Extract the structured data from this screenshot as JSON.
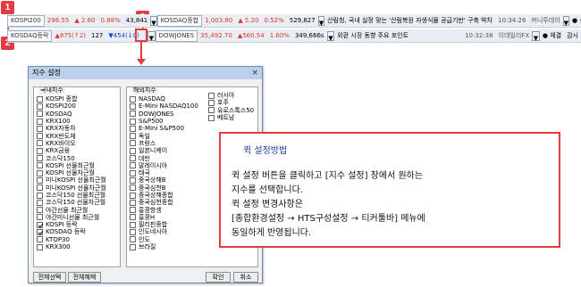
{
  "callouts": [
    "1",
    "2",
    "3"
  ],
  "ticker1": {
    "index_name": "KOSPI200",
    "value": "296.55",
    "change": "▲ 2.60",
    "pct": "0.88%",
    "volume": "43,841",
    "index_name2": "KOSDAQ종합",
    "value2": "1,003.80",
    "change2": "▲ 5.20",
    "pct2": "0.52%",
    "volume2": "529,827",
    "news": "산림청, 국내 실정 맞는 '산림복원 자생식물 공급기반' 구축 박차",
    "time": "10:34:26",
    "source": "머니투데이",
    "extra": "● 신호대기"
  },
  "ticker2": {
    "index_name": "KOSDAQ등락",
    "up": "▲875(↑2)",
    "flat": "127",
    "down": "▼454(↓0)",
    "index_name2": "DOWJONES",
    "value2": "35,492.70",
    "change2": "▲560.54",
    "pct2": "1.60%",
    "volume2": "349,666s",
    "news": "외환 시장 동향 주요 포인트",
    "time": "10:32:38",
    "source": "이데일리FX",
    "extra1": "● 체결",
    "extra2": "감시"
  },
  "dialog": {
    "title": "지수 설정",
    "close": "×",
    "domestic_title": "국내지수",
    "overseas_title": "해외지수",
    "domestic": [
      {
        "label": "KOSPI 종합",
        "checked": false
      },
      {
        "label": "KOSPI200",
        "checked": false
      },
      {
        "label": "KOSDAQ",
        "checked": false
      },
      {
        "label": "KRX100",
        "checked": false
      },
      {
        "label": "KRX자동차",
        "checked": false
      },
      {
        "label": "KRX반도체",
        "checked": false
      },
      {
        "label": "KRX바이오",
        "checked": false
      },
      {
        "label": "KRX금융",
        "checked": false
      },
      {
        "label": "코스닥150",
        "checked": false
      },
      {
        "label": "KOSPI 선물최근월",
        "checked": false
      },
      {
        "label": "KOSPI 선물차근월",
        "checked": false
      },
      {
        "label": "미니KOSPI 선물최근월",
        "checked": false
      },
      {
        "label": "미니KOSPI 선물차근월",
        "checked": false
      },
      {
        "label": "코스닥150 선물최근월",
        "checked": false
      },
      {
        "label": "코스닥150 선물차근월",
        "checked": false
      },
      {
        "label": "야간선물 최근월",
        "checked": false
      },
      {
        "label": "야간미니선물 최근월",
        "checked": false
      },
      {
        "label": "KOSPI 등락",
        "checked": true
      },
      {
        "label": "KOSDAQ 등락",
        "checked": true
      },
      {
        "label": "KTOP30",
        "checked": false
      },
      {
        "label": "KRX300",
        "checked": false
      }
    ],
    "overseas_col1": [
      {
        "label": "NASDAQ",
        "checked": false
      },
      {
        "label": "E-Mini NASDAQ100",
        "checked": false
      },
      {
        "label": "DOWJONES",
        "checked": false
      },
      {
        "label": "S&P500",
        "checked": false
      },
      {
        "label": "E-Mini S&P500",
        "checked": false
      },
      {
        "label": "독일",
        "checked": false
      },
      {
        "label": "프랑스",
        "checked": false
      },
      {
        "label": "일본니케이",
        "checked": false
      },
      {
        "label": "대만",
        "checked": false
      },
      {
        "label": "말레이시아",
        "checked": false
      },
      {
        "label": "태국",
        "checked": false
      },
      {
        "label": "중국상해B",
        "checked": false
      },
      {
        "label": "중국심천B",
        "checked": false
      },
      {
        "label": "중국상해종합",
        "checked": false
      },
      {
        "label": "중국심천종합",
        "checked": false
      },
      {
        "label": "홍콩항셍",
        "checked": false
      },
      {
        "label": "홍콩H",
        "checked": false
      },
      {
        "label": "필리핀종합",
        "checked": false
      },
      {
        "label": "인도네시아",
        "checked": false
      },
      {
        "label": "인도",
        "checked": false
      },
      {
        "label": "브라질",
        "checked": false
      }
    ],
    "overseas_col2": [
      {
        "label": "러시아",
        "checked": false
      },
      {
        "label": "호주",
        "checked": false
      },
      {
        "label": "유로스톡스50",
        "checked": false
      },
      {
        "label": "베트남",
        "checked": false
      }
    ],
    "btn_select_all": "전체선택",
    "btn_clear_all": "전체해제",
    "btn_ok": "확인",
    "btn_cancel": "취소"
  },
  "info": {
    "title": "퀵 설정방법",
    "line1": "퀵 설정 버튼을 클릭하고 [지수 설정] 창에서 원하는",
    "line2": "지수를 선택합니다.",
    "line3": "퀵 설정 변경사항은",
    "line4": "[종합환경설정 → HTS구성설정 → 티커툴바] 메뉴에",
    "line5": "동일하게 반영됩니다."
  },
  "colors": {
    "accent_red": "#e33b40",
    "up": "#e0352b",
    "down": "#1a3fcc",
    "info_title": "#1f3da0"
  }
}
